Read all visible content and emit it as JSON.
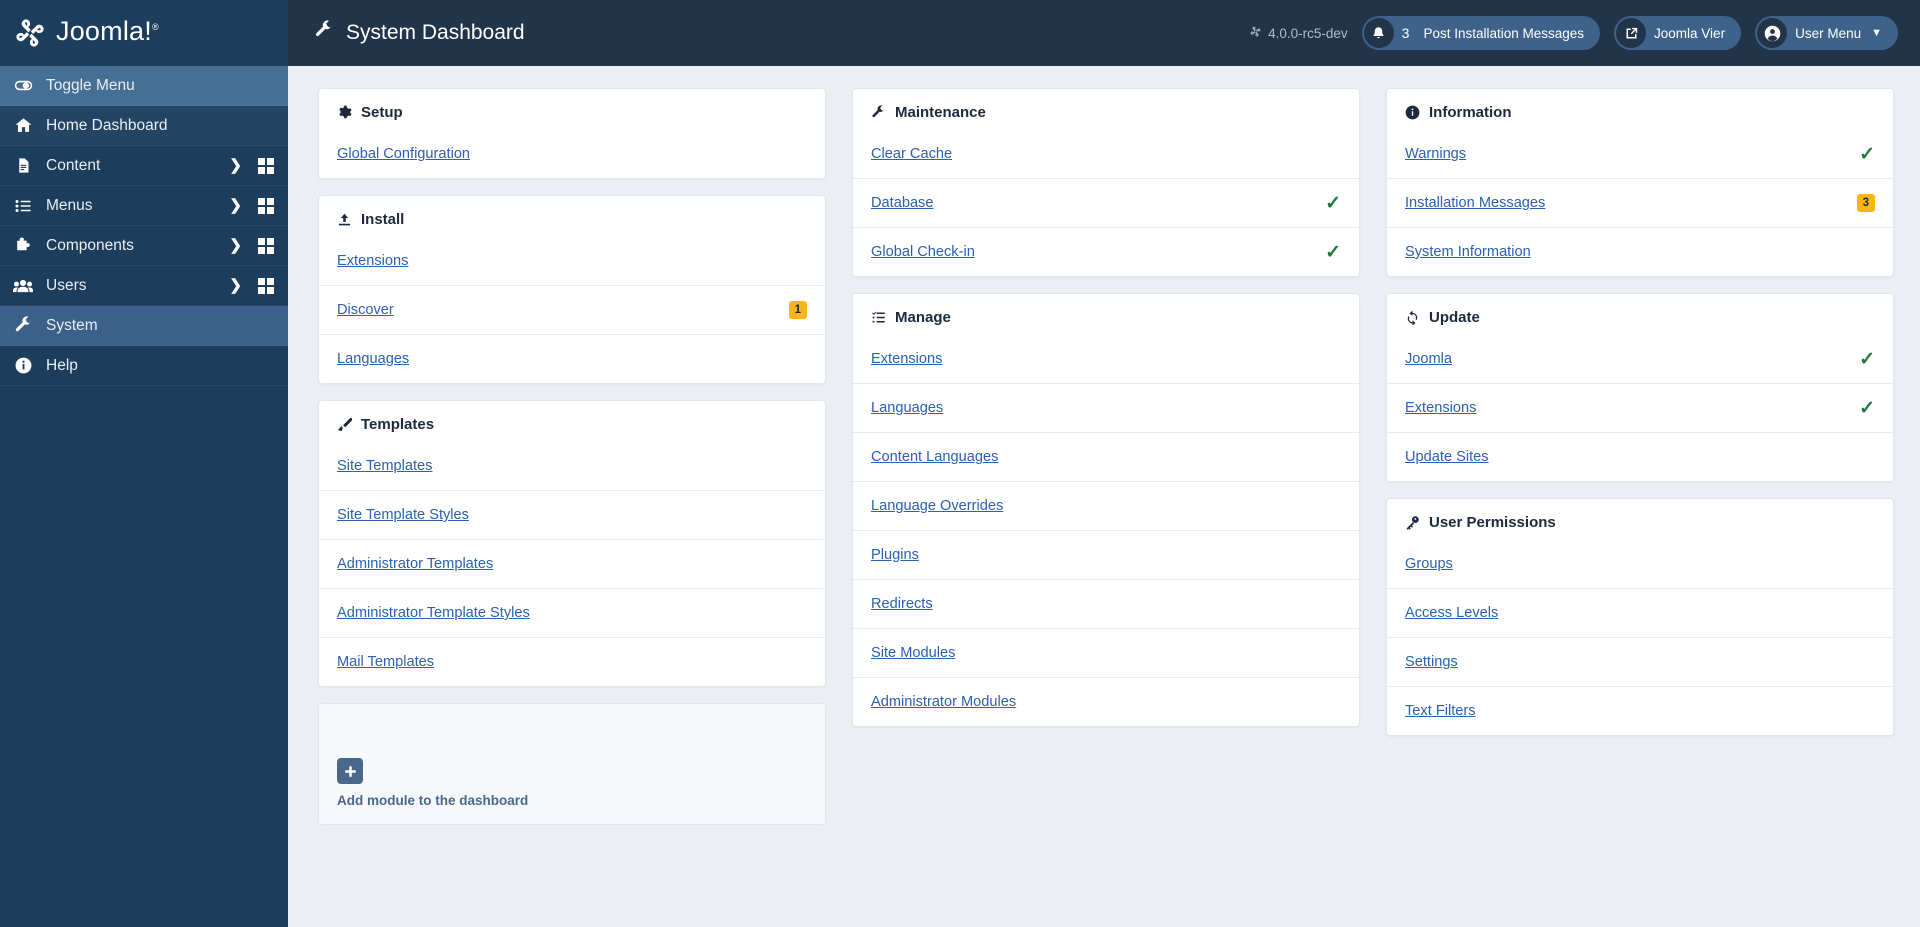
{
  "brand": {
    "name": "Joomla!",
    "registered": "®",
    "logo_icon": "joomla-logo-icon"
  },
  "sidebar": {
    "items": [
      {
        "label": "Toggle Menu",
        "icon": "toggle-icon",
        "state": "toggle",
        "has_chevron": false,
        "has_grid": false
      },
      {
        "label": "Home Dashboard",
        "icon": "home-icon",
        "state": "home",
        "has_chevron": false,
        "has_grid": false
      },
      {
        "label": "Content",
        "icon": "document-icon",
        "state": "",
        "has_chevron": true,
        "has_grid": true
      },
      {
        "label": "Menus",
        "icon": "list-icon",
        "state": "",
        "has_chevron": true,
        "has_grid": true
      },
      {
        "label": "Components",
        "icon": "puzzle-icon",
        "state": "",
        "has_chevron": true,
        "has_grid": true
      },
      {
        "label": "Users",
        "icon": "users-icon",
        "state": "",
        "has_chevron": true,
        "has_grid": true
      },
      {
        "label": "System",
        "icon": "wrench-icon",
        "state": "active",
        "has_chevron": false,
        "has_grid": false
      },
      {
        "label": "Help",
        "icon": "info-circle-icon",
        "state": "",
        "has_chevron": false,
        "has_grid": false
      }
    ]
  },
  "header": {
    "title": "System Dashboard",
    "title_icon": "wrench-icon",
    "version": "4.0.0-rc5-dev",
    "version_icon": "joomla-mark-icon",
    "messages": {
      "label": "Post Installation Messages",
      "count": "3",
      "icon": "bell-icon"
    },
    "preview": {
      "label": "Joomla Vier",
      "icon": "external-link-icon"
    },
    "user": {
      "label": "User Menu",
      "icon": "user-circle-icon",
      "caret": "chevron-down-icon"
    }
  },
  "columns": [
    {
      "cards": [
        {
          "title": "Setup",
          "icon": "gear-icon",
          "rows": [
            {
              "label": "Global Configuration",
              "status": "",
              "badge": ""
            }
          ]
        },
        {
          "title": "Install",
          "icon": "upload-icon",
          "rows": [
            {
              "label": "Extensions",
              "status": "",
              "badge": ""
            },
            {
              "label": "Discover",
              "status": "",
              "badge": "1"
            },
            {
              "label": "Languages",
              "status": "",
              "badge": ""
            }
          ]
        },
        {
          "title": "Templates",
          "icon": "brush-icon",
          "rows": [
            {
              "label": "Site Templates",
              "status": "",
              "badge": ""
            },
            {
              "label": "Site Template Styles",
              "status": "",
              "badge": ""
            },
            {
              "label": "Administrator Templates",
              "status": "",
              "badge": ""
            },
            {
              "label": "Administrator Template Styles",
              "status": "",
              "badge": ""
            },
            {
              "label": "Mail Templates",
              "status": "",
              "badge": ""
            }
          ]
        }
      ],
      "add_module": {
        "label": "Add module to the dashboard",
        "icon": "plus-icon"
      }
    },
    {
      "cards": [
        {
          "title": "Maintenance",
          "icon": "wrench-icon",
          "rows": [
            {
              "label": "Clear Cache",
              "status": "",
              "badge": ""
            },
            {
              "label": "Database",
              "status": "ok",
              "badge": ""
            },
            {
              "label": "Global Check-in",
              "status": "ok",
              "badge": ""
            }
          ]
        },
        {
          "title": "Manage",
          "icon": "checklist-icon",
          "rows": [
            {
              "label": "Extensions",
              "status": "",
              "badge": ""
            },
            {
              "label": "Languages",
              "status": "",
              "badge": ""
            },
            {
              "label": "Content Languages",
              "status": "",
              "badge": ""
            },
            {
              "label": "Language Overrides",
              "status": "",
              "badge": ""
            },
            {
              "label": "Plugins",
              "status": "",
              "badge": ""
            },
            {
              "label": "Redirects",
              "status": "",
              "badge": ""
            },
            {
              "label": "Site Modules",
              "status": "",
              "badge": ""
            },
            {
              "label": "Administrator Modules",
              "status": "",
              "badge": ""
            }
          ]
        }
      ],
      "add_module": null
    },
    {
      "cards": [
        {
          "title": "Information",
          "icon": "info-circle-icon",
          "rows": [
            {
              "label": "Warnings",
              "status": "ok",
              "badge": ""
            },
            {
              "label": "Installation Messages",
              "status": "",
              "badge": "3"
            },
            {
              "label": "System Information",
              "status": "",
              "badge": ""
            }
          ]
        },
        {
          "title": "Update",
          "icon": "refresh-icon",
          "rows": [
            {
              "label": "Joomla",
              "status": "ok",
              "badge": ""
            },
            {
              "label": "Extensions",
              "status": "ok",
              "badge": ""
            },
            {
              "label": "Update Sites",
              "status": "",
              "badge": ""
            }
          ]
        },
        {
          "title": "User Permissions",
          "icon": "key-icon",
          "rows": [
            {
              "label": "Groups",
              "status": "",
              "badge": ""
            },
            {
              "label": "Access Levels",
              "status": "",
              "badge": ""
            },
            {
              "label": "Settings",
              "status": "",
              "badge": ""
            },
            {
              "label": "Text Filters",
              "status": "",
              "badge": ""
            }
          ]
        }
      ],
      "add_module": null
    }
  ],
  "colors": {
    "sidebar_bg": "#1c3d5c",
    "topbar_bg": "#22344a",
    "accent_link": "#2a61b0",
    "badge_bg": "#ffb416",
    "check_green": "#1f7a3c",
    "page_bg": "#ebeff3"
  }
}
